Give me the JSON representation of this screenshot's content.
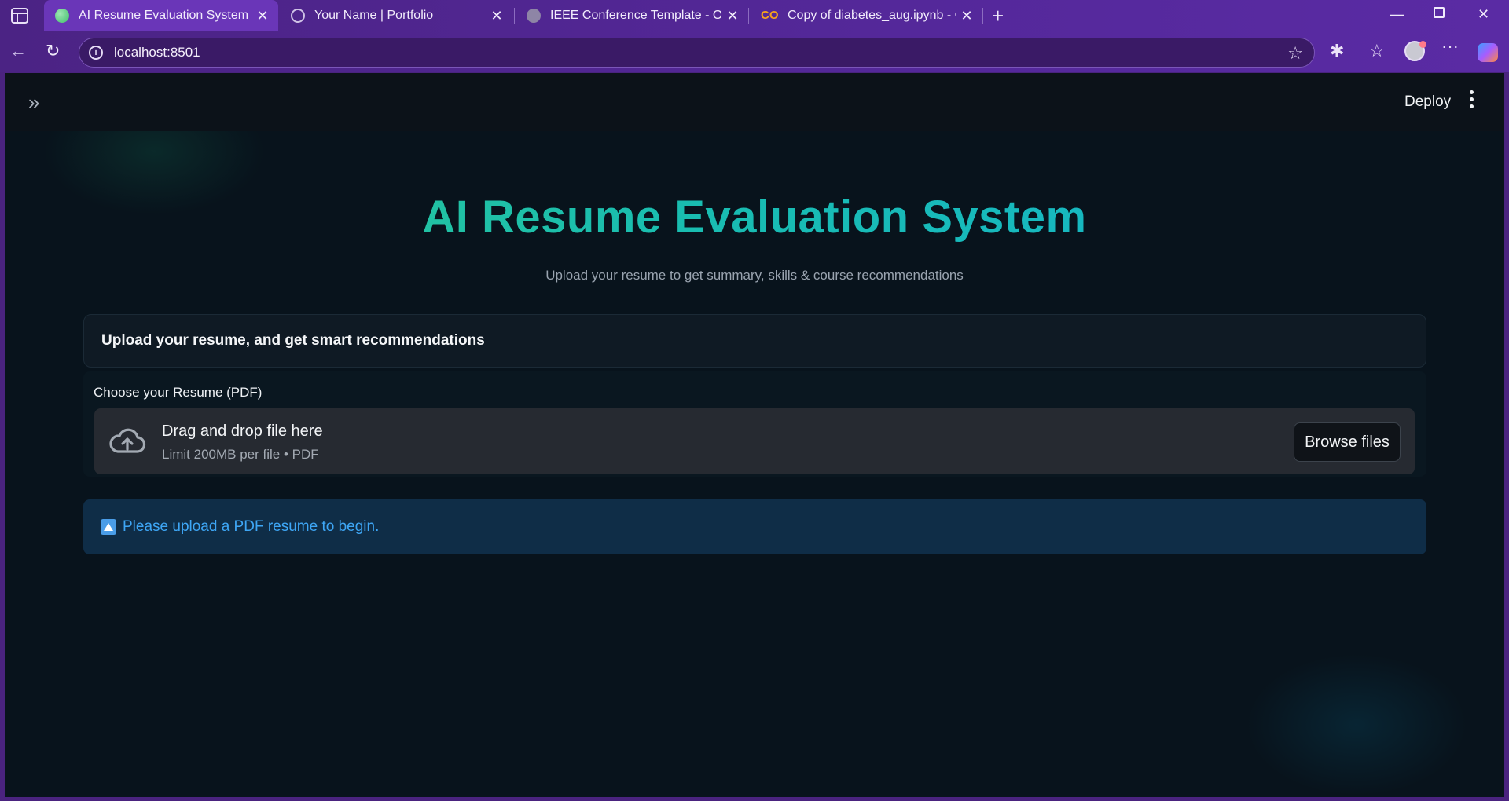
{
  "browser": {
    "tabs": [
      {
        "title": "AI Resume Evaluation System",
        "icon": "streamlit-favicon",
        "active": true
      },
      {
        "title": "Your Name | Portfolio",
        "icon": "globe-icon",
        "active": false
      },
      {
        "title": "IEEE Conference Template - Onlin",
        "icon": "overleaf-icon",
        "active": false
      },
      {
        "title": "Copy of diabetes_aug.ipynb - Col",
        "icon": "colab-icon",
        "active": false
      }
    ],
    "url": "localhost:8501"
  },
  "app": {
    "header": {
      "deploy_label": "Deploy"
    },
    "title": "AI Resume Evaluation System",
    "subtitle": "Upload your resume to get summary, skills & course recommendations",
    "upload_card_title": "Upload your resume, and get smart recommendations",
    "uploader": {
      "label": "Choose your Resume (PDF)",
      "drop_text": "Drag and drop file here",
      "limit_text": "Limit 200MB per file • PDF",
      "browse_label": "Browse files"
    },
    "alert": {
      "text": "Please upload a PDF resume to begin.",
      "icon": "up-arrow-icon"
    }
  },
  "colors": {
    "title_gradient_start": "#2fc98f",
    "title_gradient_end": "#14b3cf",
    "alert_text": "#3ea6f5",
    "browser_chrome": "#4b2384"
  }
}
